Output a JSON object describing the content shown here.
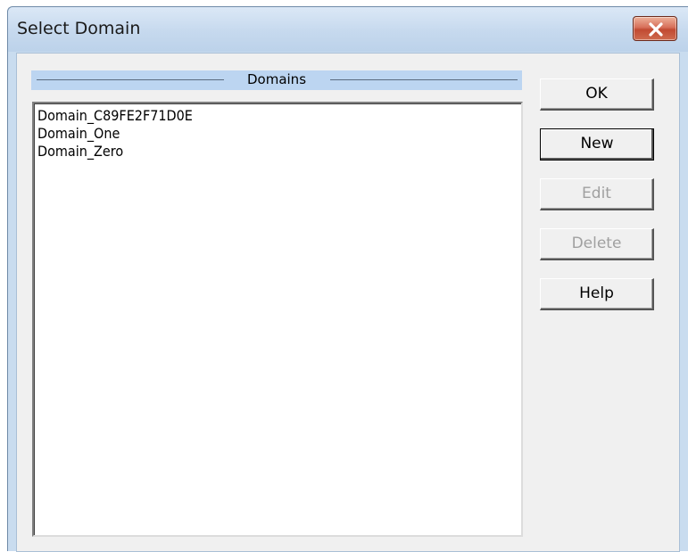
{
  "window": {
    "title": "Select Domain",
    "close_icon": "close-x-icon"
  },
  "domains": {
    "header": "Domains",
    "items": [
      "Domain_C89FE2F71D0E",
      "Domain_One",
      "Domain_Zero"
    ]
  },
  "buttons": {
    "ok": "OK",
    "new": "New",
    "edit": "Edit",
    "delete": "Delete",
    "help": "Help"
  },
  "colors": {
    "title_bar": "#c6d9ee",
    "close_button": "#c14a32",
    "client_bg": "#f0f0f0",
    "header_band": "#bcd5f1",
    "disabled_text": "#a0a0a0"
  }
}
